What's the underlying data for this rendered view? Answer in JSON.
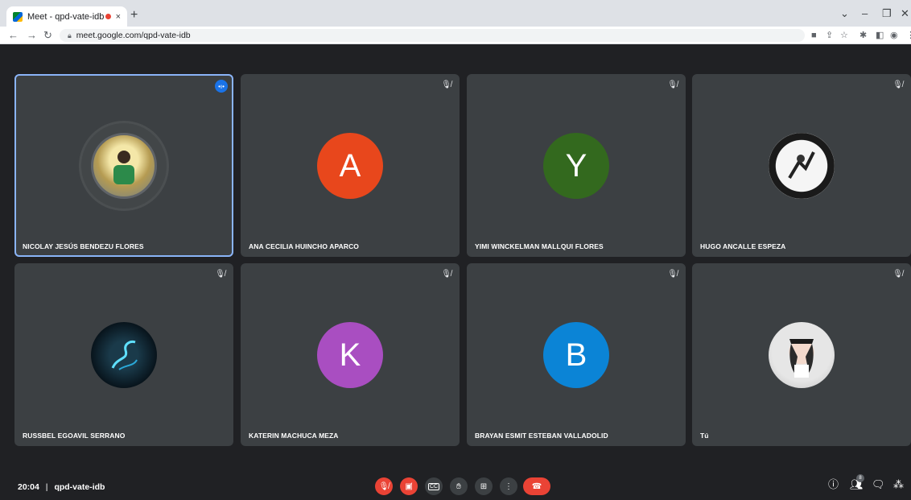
{
  "browser": {
    "tab_title": "Meet - qpd-vate-idb",
    "tab_close": "×",
    "new_tab": "+",
    "url": "meet.google.com/qpd-vate-idb",
    "window_controls": [
      "⌄",
      "–",
      "❐",
      "✕"
    ]
  },
  "tiles": [
    {
      "name": "NICOLAY JESÚS BENDEZU FLORES",
      "avatar_type": "photo",
      "speaking": true
    },
    {
      "name": "ANA CECILIA HUINCHO APARCO",
      "avatar_type": "letter",
      "letter": "A",
      "color": "#e8471c"
    },
    {
      "name": "YIMI WINCKELMAN MALLQUI FLORES",
      "avatar_type": "letter",
      "letter": "Y",
      "color": "#33691e"
    },
    {
      "name": "HUGO ANCALLE ESPEZA",
      "avatar_type": "photo"
    },
    {
      "name": "RUSSBEL EGOAVIL SERRANO",
      "avatar_type": "photo"
    },
    {
      "name": "KATERIN MACHUCA MEZA",
      "avatar_type": "letter",
      "letter": "K",
      "color": "#a94ec1"
    },
    {
      "name": "BRAYAN ESMIT ESTEBAN VALLADOLID",
      "avatar_type": "letter",
      "letter": "B",
      "color": "#0b84d6"
    },
    {
      "name": "Tú",
      "avatar_type": "photo"
    }
  ],
  "bottombar": {
    "time": "20:04",
    "separator": "|",
    "meeting_code": "qpd-vate-idb",
    "people_count": "8"
  },
  "colors": {
    "background": "#202124",
    "tile": "#3c4043",
    "active_outline": "#8ab4f8",
    "danger": "#ea4335"
  }
}
